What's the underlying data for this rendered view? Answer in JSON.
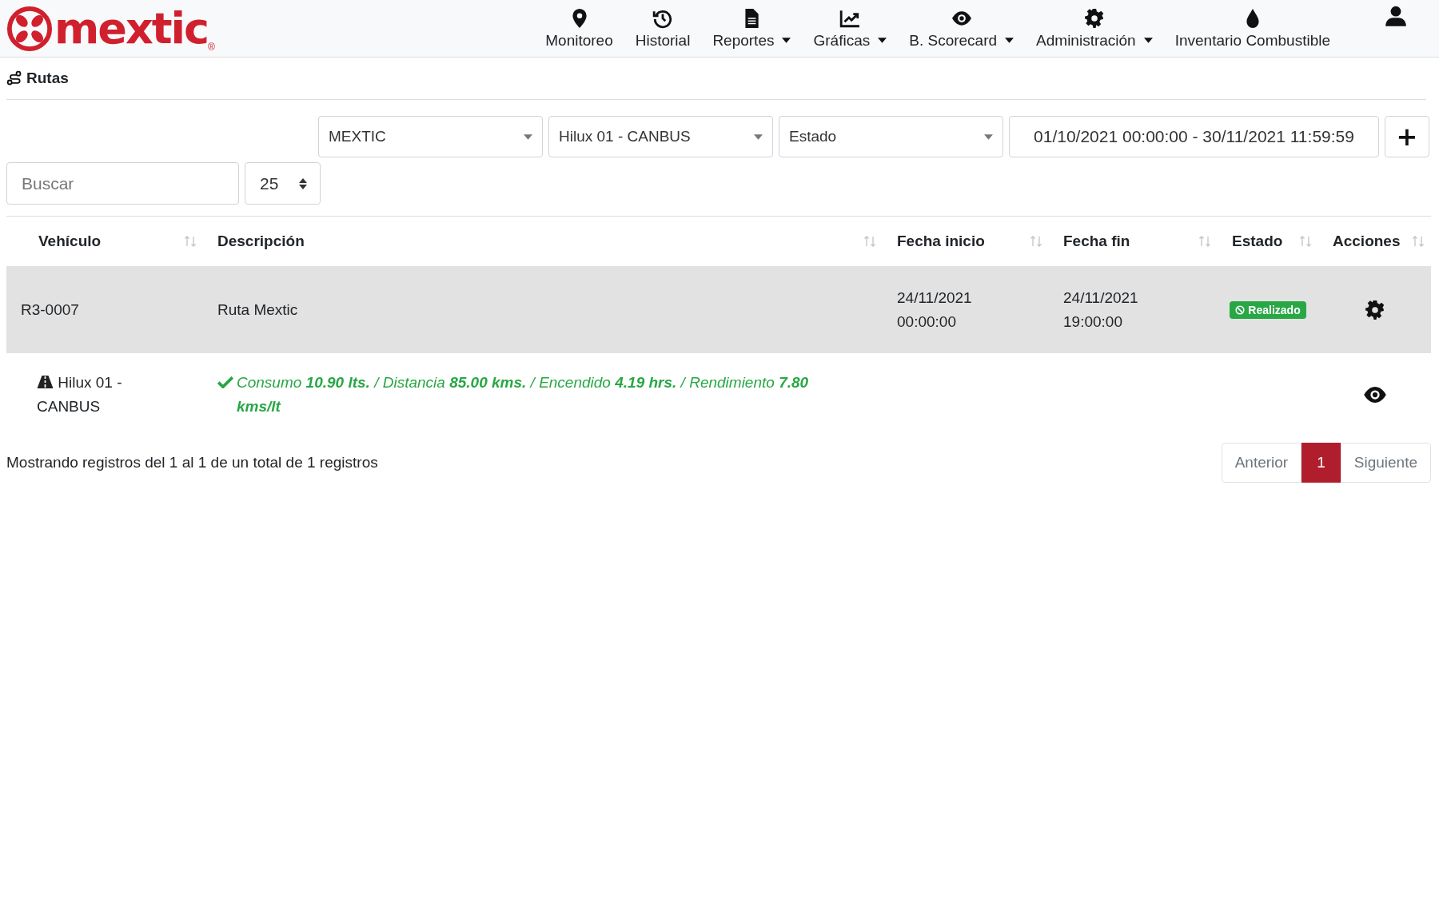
{
  "brand": {
    "name": "mextic",
    "mark": "®"
  },
  "nav": [
    {
      "label": "Monitoreo",
      "dropdown": false
    },
    {
      "label": "Historial",
      "dropdown": false
    },
    {
      "label": "Reportes",
      "dropdown": true
    },
    {
      "label": "Gráficas",
      "dropdown": true
    },
    {
      "label": "B. Scorecard",
      "dropdown": true
    },
    {
      "label": "Administración",
      "dropdown": true
    },
    {
      "label": "Inventario Combustible",
      "dropdown": false
    }
  ],
  "page_title": "Rutas",
  "filters": [
    {
      "value": "MEXTIC"
    },
    {
      "value": "Hilux 01 - CANBUS"
    },
    {
      "value": "Estado"
    }
  ],
  "date_range": "01/10/2021 00:00:00 - 30/11/2021 11:59:59",
  "add_button": "+",
  "search": {
    "placeholder": "Buscar"
  },
  "page_size": "25",
  "table": {
    "columns": [
      "Vehículo",
      "Descripción",
      "Fecha inicio",
      "Fecha fin",
      "Estado",
      "Acciones"
    ],
    "rows": [
      {
        "kind": "route",
        "vehicle": "R3-0007",
        "description": "Ruta Mextic",
        "start": "24/11/2021 00:00:00",
        "end": "24/11/2021 19:00:00",
        "status": "Realizado"
      },
      {
        "kind": "detail",
        "vehicle": "Hilux 01 - CANBUS",
        "description": "Consumo **10.90 lts.** / Distancia **85.00 kms.** / Encendido **4.19 hrs.** / Rendimiento **7.80 kms/lt**"
      }
    ]
  },
  "footer_info": "Mostrando registros del 1 al 1 de un total de 1 registros",
  "pagination": [
    {
      "label": "Anterior",
      "selected": false
    },
    {
      "label": "1",
      "selected": true
    },
    {
      "label": "Siguiente",
      "selected": false
    }
  ]
}
